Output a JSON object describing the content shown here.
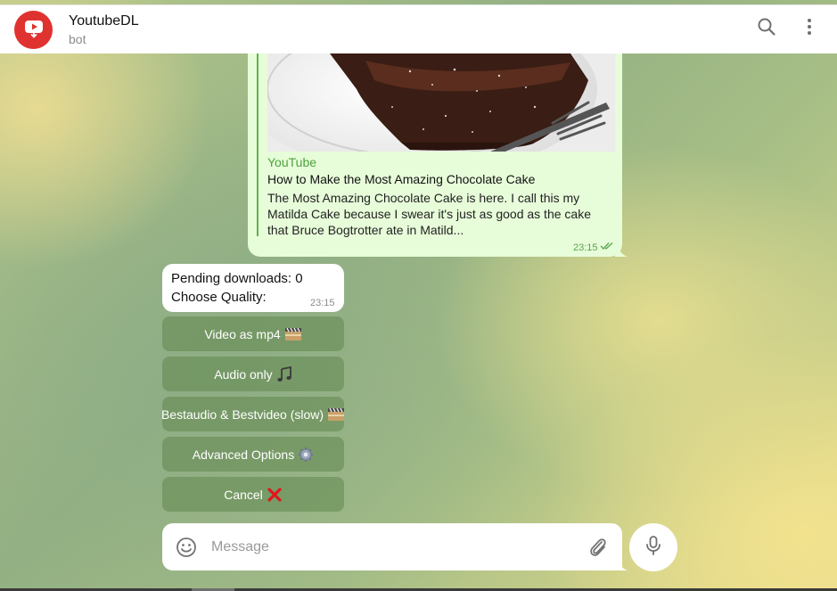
{
  "header": {
    "title": "YoutubeDL",
    "subtitle": "bot",
    "avatar_icon": "youtube-play-icon",
    "search_icon": "search-icon",
    "menu_icon": "more-vertical-icon"
  },
  "messages": {
    "outgoing": {
      "site_name": "YouTube",
      "link_title": "How to Make the Most Amazing Chocolate Cake",
      "link_description": "The Most Amazing Chocolate Cake is here. I call this my Matilda Cake because I swear it's just as good as the cake that Bruce Bogtrotter ate in Matild...",
      "time": "23:15",
      "status_icon": "double-check-icon"
    },
    "incoming": {
      "line1": "Pending downloads: 0",
      "line2": "Choose Quality:",
      "time": "23:15"
    }
  },
  "keyboard": {
    "buttons": [
      {
        "label": "Video as mp4",
        "icon": "film-reel-icon"
      },
      {
        "label": "Audio only",
        "icon": "music-note-icon"
      },
      {
        "label": "Bestaudio & Bestvideo (slow)",
        "icon": "film-reel-icon"
      },
      {
        "label": "Advanced Options",
        "icon": "gear-icon"
      },
      {
        "label": "Cancel",
        "icon": "cross-icon"
      }
    ]
  },
  "composer": {
    "placeholder": "Message",
    "emoji_icon": "smile-icon",
    "attach_icon": "paperclip-icon",
    "mic_icon": "microphone-icon"
  },
  "colors": {
    "accent_green": "#4ca33c",
    "bubble_out": "#e7fcd9",
    "youtube_red": "#e0322f"
  }
}
